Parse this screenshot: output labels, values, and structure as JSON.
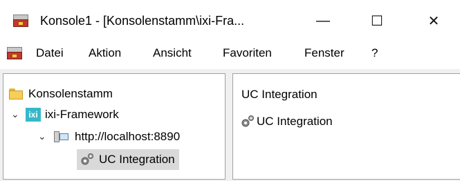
{
  "window": {
    "title": "Konsole1 - [Konsolenstamm\\ixi-Fra...",
    "minimize_glyph": "—",
    "maximize_glyph": "☐",
    "close_glyph": "✕",
    "app_icon": "mmc-console-icon"
  },
  "menubar": {
    "items": [
      "Datei",
      "Aktion",
      "Ansicht",
      "Favoriten",
      "Fenster",
      "?"
    ]
  },
  "tree": {
    "root": {
      "label": "Konsolenstamm",
      "icon": "folder-icon"
    },
    "framework": {
      "label": "ixi-Framework",
      "icon": "ixi-icon",
      "expanded": true
    },
    "server": {
      "label": "http://localhost:8890",
      "icon": "server-icon",
      "expanded": true
    },
    "uc": {
      "label": "UC Integration",
      "icon": "gear-icon",
      "selected": true
    }
  },
  "result": {
    "header": "UC Integration",
    "items": [
      {
        "label": "UC Integration",
        "icon": "gear-icon"
      }
    ]
  },
  "colors": {
    "selection_bg": "#d9d9d9",
    "ixi_brand": "#36b8c9"
  }
}
